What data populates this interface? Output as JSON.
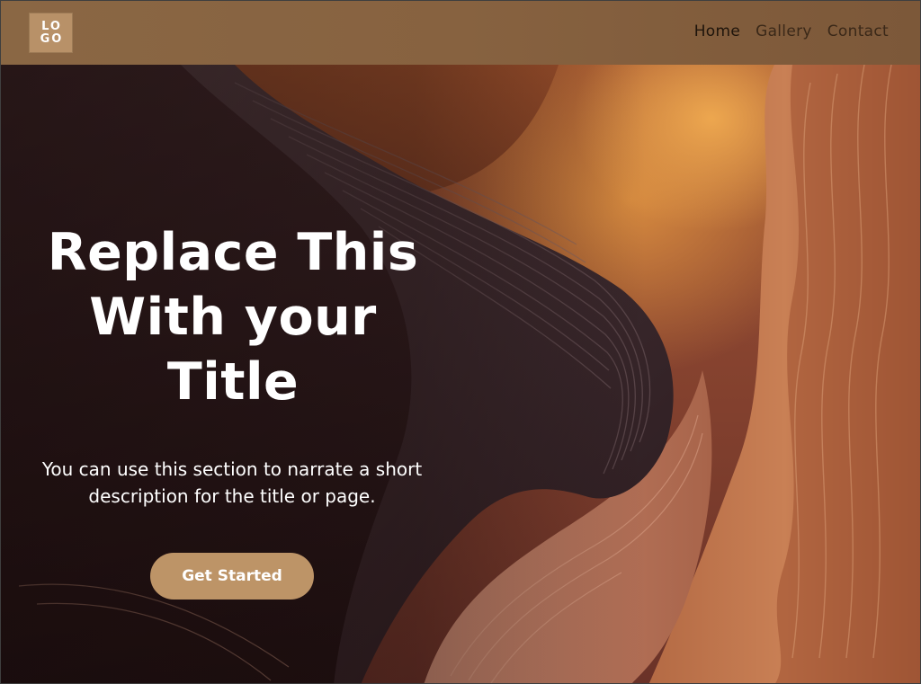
{
  "logo": {
    "line1": "LO",
    "line2": "GO"
  },
  "nav": {
    "items": [
      {
        "label": "Home"
      },
      {
        "label": "Gallery"
      },
      {
        "label": "Contact"
      }
    ]
  },
  "hero": {
    "title": "Replace This With your Title",
    "description": "You can use this section to narrate a short description for the title or page.",
    "cta_label": "Get Started"
  },
  "colors": {
    "header": "#876240",
    "logo_bg": "#b89168",
    "cta_bg": "#bd9467",
    "text_light": "#ffffff"
  }
}
